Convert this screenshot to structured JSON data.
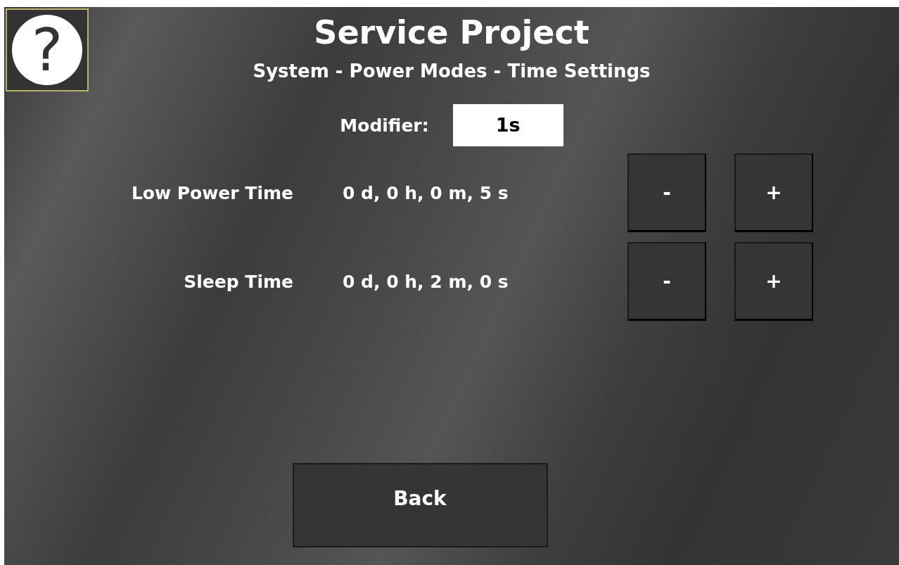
{
  "help_button": {
    "symbol": "?"
  },
  "title": "Service Project",
  "subtitle": "System - Power Modes - Time Settings",
  "modifier": {
    "label": "Modifier:",
    "value": "1s"
  },
  "rows": [
    {
      "label": "Low Power Time",
      "value": "0 d, 0 h, 0 m, 5 s",
      "buttons": [
        "-",
        "+"
      ]
    },
    {
      "label": "Sleep Time",
      "value": "0 d, 0 h, 2 m, 0 s",
      "buttons": [
        "-",
        "+"
      ]
    }
  ],
  "back_button": {
    "label": "Back"
  }
}
